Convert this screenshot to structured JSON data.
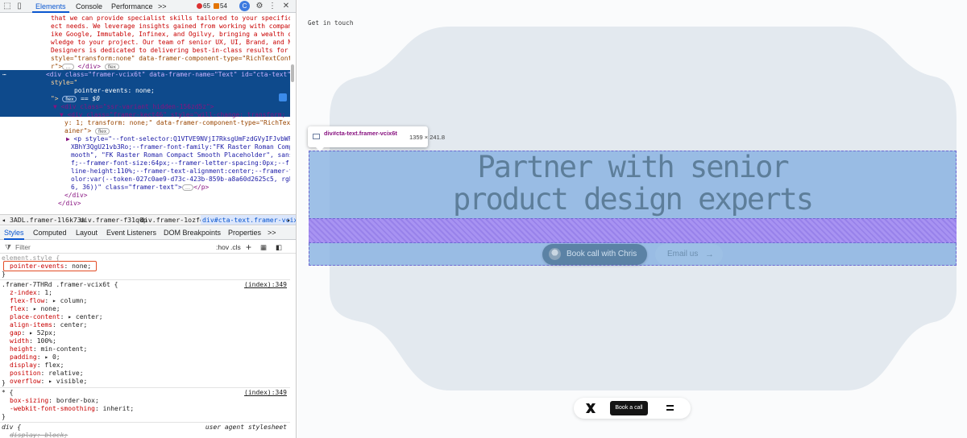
{
  "devtools": {
    "tabs": [
      "Elements",
      "Console",
      "Performance"
    ],
    "more_tabs": ">>",
    "error_count": "65",
    "warning_count": "54",
    "dom_lines": {
      "l1": "that we can provide specialist skills tailored to your specific proj",
      "l2": "ect needs. We leverage insights gained from working with companies l",
      "l3": "ike Google, Immutable, Infinex, and Ogilvy, bringing a wealth of kno",
      "l4": "wledge to your project. Our team of senior UX, UI, Brand, and Motion",
      "l5": "Designers is dedicated to delivering best-in-class results for you.\"",
      "l6_a": "style=\"transform:none\" data-framer-component-type=\"RichTextContaine",
      "l7_a": "r\">",
      "l7_b": "</div>",
      "sel_1": "<div class=\"framer-vcix6t\" data-framer-name=\"Text\" id=\"cta-text\"",
      "sel_2": "style=\"",
      "sel_3": "pointer-events: none;",
      "sel_4a": "\">",
      "sel_4b": "== $0",
      "l8": "<div class=\"ssr-variant hidden-156zd5z\">",
      "l9": "<div class=\"framer-kect46\" style=\"will-change: transform; opacit",
      "l10": "y: 1; transform: none;\" data-framer-component-type=\"RichTextCont",
      "l11": "ainer\">",
      "l12": "<p style=\"--font-selector:Q1VTVE9NVjI7RksgUmFzdGVyIFJvbWFuIENvb",
      "l13": "XBhY3QgU21vb3Ro;--framer-font-family:\"FK Raster Roman Compact S",
      "l14": "mooth\", \"FK Raster Roman Compact Smooth Placeholder\", sans-seri",
      "l15": "f;--framer-font-size:64px;--framer-letter-spacing:0px;--framer-",
      "l16": "line-height:110%;--framer-text-alignment:center;--framer-text-c",
      "l17": "olor:var(--token-027c0ae9-d73c-423b-859b-a8a60d2625c5, rgb(5, 2",
      "l18": "6, 36))\" class=\"framer-text\">",
      "l18_b": "</p>",
      "l19": "</div>",
      "l20": "</div>",
      "flex": "flex",
      "ellipsis": "…"
    },
    "breadcrumbs": [
      "3ADL.framer-1l6k73a",
      "div.framer-f31q0p",
      "div.framer-1ozfe4i",
      "div#cta-text.framer-vcix6t"
    ],
    "subtabs": [
      "Styles",
      "Computed",
      "Layout",
      "Event Listeners",
      "DOM Breakpoints",
      "Properties"
    ],
    "filter": {
      "placeholder": "Filter",
      "hov": ":hov",
      "cls": ".cls",
      "plus": "+"
    },
    "styles": {
      "element_style": "element.style {",
      "es_prop": "pointer-events",
      "es_val": "none;",
      "close": "}",
      "rule1_selector": ".framer-7THRd .framer-vcix6t {",
      "rule1_link": "(index):349",
      "rule1_props": [
        {
          "p": "z-index",
          "v": "1;"
        },
        {
          "p": "flex-flow",
          "v": "▸ column;"
        },
        {
          "p": "flex",
          "v": "▸ none;"
        },
        {
          "p": "place-content",
          "v": "▸ center;"
        },
        {
          "p": "align-items",
          "v": "center;"
        },
        {
          "p": "gap",
          "v": "▸ 52px;"
        },
        {
          "p": "width",
          "v": "100%;"
        },
        {
          "p": "height",
          "v": "min-content;"
        },
        {
          "p": "padding",
          "v": "▸ 0;"
        },
        {
          "p": "display",
          "v": "flex;"
        },
        {
          "p": "position",
          "v": "relative;"
        },
        {
          "p": "overflow",
          "v": "▸ visible;"
        }
      ],
      "rule2_selector": "* {",
      "rule2_link": "(index):349",
      "rule2_props": [
        {
          "p": "box-sizing",
          "v": "border-box;"
        },
        {
          "p": "-webkit-font-smoothing",
          "v": "inherit;"
        }
      ],
      "rule3_selector": "div {",
      "rule3_link": "user agent stylesheet",
      "rule3_prop": "display: block;"
    }
  },
  "page": {
    "get_in_touch": "Get in touch",
    "headline_line1": "Partner with senior",
    "headline_line2": "product design experts",
    "cta_primary": "Book call with Chris",
    "cta_secondary": "Email us",
    "cta_arrow": "→",
    "tooltip_name": "div#cta-text.framer-vcix6t",
    "tooltip_size": "1359 × 241.8",
    "nav_book": "Book a call"
  },
  "colors": {
    "selected_row": "#0e4a8c",
    "highlight": "#84afe0",
    "gap_highlight": "#9878eb",
    "blob": "#e3e9ef",
    "accent_blue": "#0b57d0"
  }
}
